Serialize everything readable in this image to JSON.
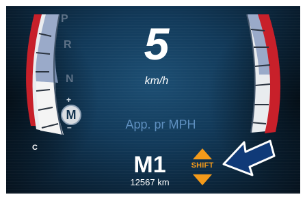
{
  "transmission": {
    "gears": [
      "P",
      "R",
      "N"
    ],
    "manual_mode": "M",
    "upshift_symbol": "+",
    "downshift_symbol": "–"
  },
  "speed": {
    "value": "5",
    "unit": "km/h"
  },
  "message": "App. pr MPH",
  "gear_mode": "M1",
  "odometer": "12567 km",
  "shift": {
    "label": "SHIFT",
    "color": "#f39a1a"
  },
  "left_gauge_label": "C",
  "colors": {
    "background": "#123a5a",
    "gauge_red": "#c8202a",
    "gauge_face": "#f2f2f2",
    "gauge_shade": "#8c9fc2",
    "message_blue": "#5e8fbf"
  }
}
